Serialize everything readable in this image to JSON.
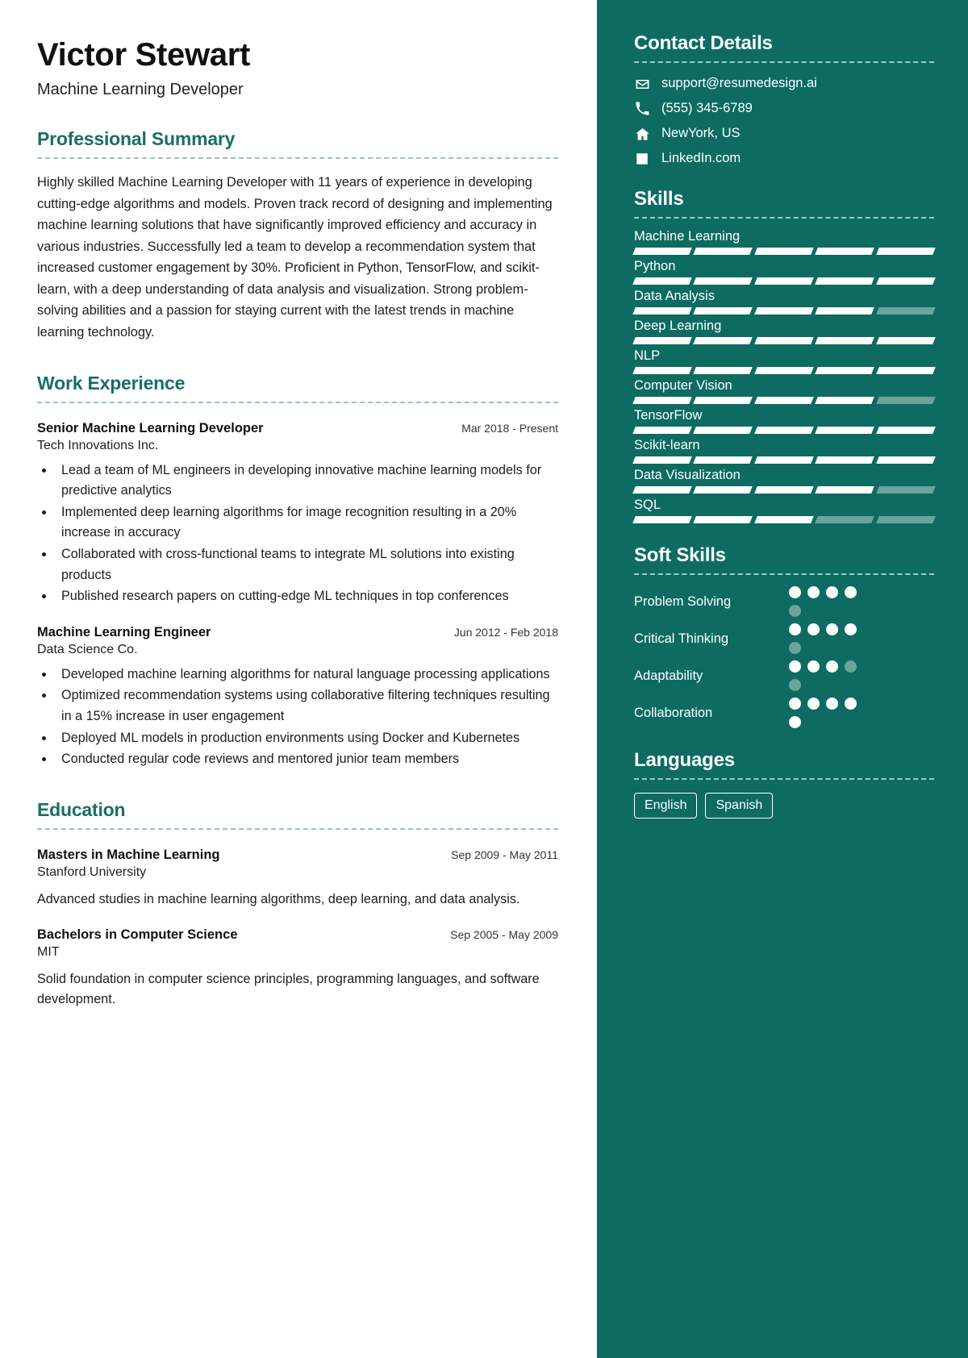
{
  "colors": {
    "sidebar_bg": "#0d6b62",
    "accent": "#1a6f63",
    "page_bg": "#ffffff",
    "muted_segment": "#6ea39c"
  },
  "header": {
    "name": "Victor Stewart",
    "job_title": "Machine Learning Developer"
  },
  "sections": {
    "summary": {
      "title": "Professional Summary",
      "text": "Highly skilled Machine Learning Developer with 11 years of experience in developing cutting-edge algorithms and models. Proven track record of designing and implementing machine learning solutions that have significantly improved efficiency and accuracy in various industries. Successfully led a team to develop a recommendation system that increased customer engagement by 30%. Proficient in Python, TensorFlow, and scikit-learn, with a deep understanding of data analysis and visualization. Strong problem-solving abilities and a passion for staying current with the latest trends in machine learning technology."
    },
    "work": {
      "title": "Work Experience",
      "entries": [
        {
          "role": "Senior Machine Learning Developer",
          "date": "Mar 2018 - Present",
          "org": "Tech Innovations Inc.",
          "bullets": [
            "Lead a team of ML engineers in developing innovative machine learning models for predictive analytics",
            "Implemented deep learning algorithms for image recognition resulting in a 20% increase in accuracy",
            "Collaborated with cross-functional teams to integrate ML solutions into existing products",
            "Published research papers on cutting-edge ML techniques in top conferences"
          ]
        },
        {
          "role": "Machine Learning Engineer",
          "date": "Jun 2012 - Feb 2018",
          "org": "Data Science Co.",
          "bullets": [
            "Developed machine learning algorithms for natural language processing applications",
            "Optimized recommendation systems using collaborative filtering techniques resulting in a 15% increase in user engagement",
            "Deployed ML models in production environments using Docker and Kubernetes",
            "Conducted regular code reviews and mentored junior team members"
          ]
        }
      ]
    },
    "education": {
      "title": "Education",
      "entries": [
        {
          "degree": "Masters in Machine Learning",
          "date": "Sep 2009 - May 2011",
          "school": "Stanford University",
          "description": "Advanced studies in machine learning algorithms, deep learning, and data analysis."
        },
        {
          "degree": "Bachelors in Computer Science",
          "date": "Sep 2005 - May 2009",
          "school": "MIT",
          "description": "Solid foundation in computer science principles, programming languages, and software development."
        }
      ]
    }
  },
  "sidebar": {
    "contact": {
      "title": "Contact Details",
      "items": [
        {
          "icon": "email-icon",
          "text": "support@resumedesign.ai"
        },
        {
          "icon": "phone-icon",
          "text": "(555) 345-6789"
        },
        {
          "icon": "home-icon",
          "text": "NewYork, US"
        },
        {
          "icon": "linkedin-icon",
          "text": "LinkedIn.com"
        }
      ]
    },
    "skills": {
      "title": "Skills",
      "segments_total": 5,
      "items": [
        {
          "label": "Machine Learning",
          "filled": 5
        },
        {
          "label": "Python",
          "filled": 5
        },
        {
          "label": "Data Analysis",
          "filled": 4
        },
        {
          "label": "Deep Learning",
          "filled": 5
        },
        {
          "label": "NLP",
          "filled": 5
        },
        {
          "label": "Computer Vision",
          "filled": 4
        },
        {
          "label": "TensorFlow",
          "filled": 5
        },
        {
          "label": "Scikit-learn",
          "filled": 5
        },
        {
          "label": "Data Visualization",
          "filled": 4
        },
        {
          "label": "SQL",
          "filled": 3
        }
      ]
    },
    "soft_skills": {
      "title": "Soft Skills",
      "dots_total": 5,
      "items": [
        {
          "label": "Problem Solving",
          "filled": 4
        },
        {
          "label": "Critical Thinking",
          "filled": 4
        },
        {
          "label": "Adaptability",
          "filled": 3
        },
        {
          "label": "Collaboration",
          "filled": 5
        }
      ]
    },
    "languages": {
      "title": "Languages",
      "items": [
        "English",
        "Spanish"
      ]
    }
  }
}
